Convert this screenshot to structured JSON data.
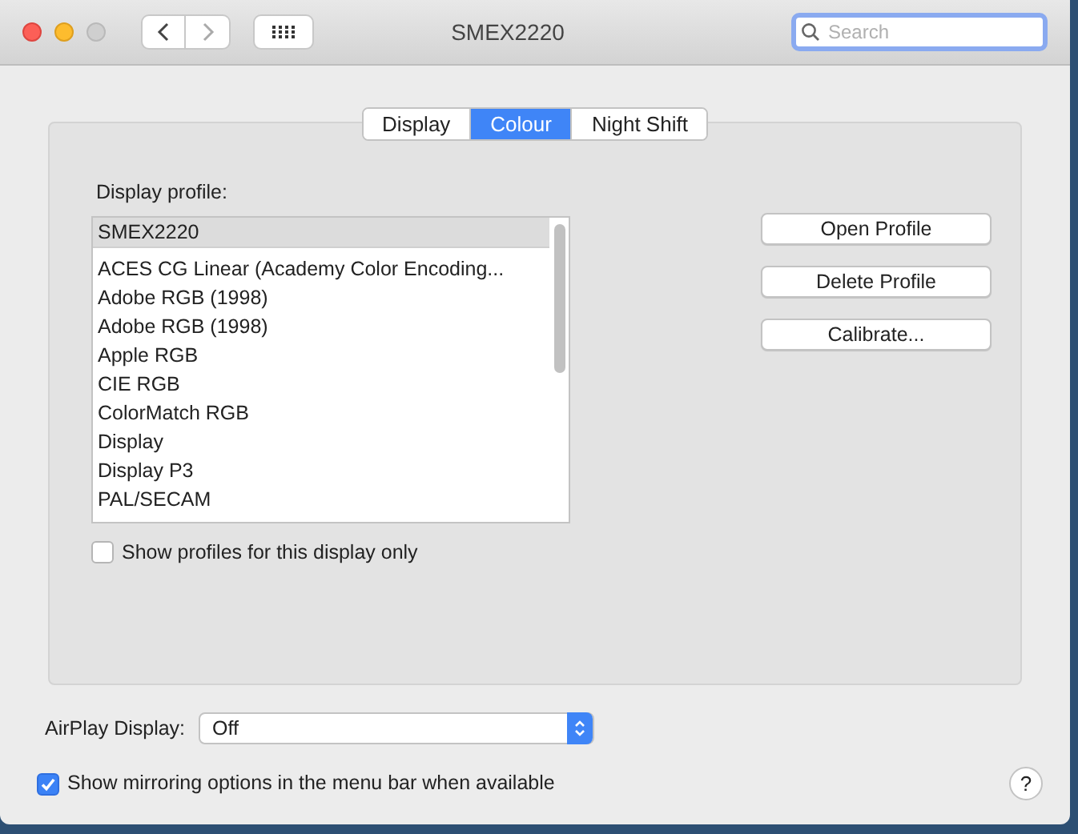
{
  "window": {
    "title": "SMEX2220",
    "search": {
      "placeholder": "Search"
    }
  },
  "tabs": [
    {
      "label": "Display",
      "selected": false
    },
    {
      "label": "Colour",
      "selected": true
    },
    {
      "label": "Night Shift",
      "selected": false
    }
  ],
  "profile_label": "Display profile:",
  "profiles": [
    {
      "label": "SMEX2220",
      "selected": true
    },
    {
      "label": "ACES CG Linear (Academy Color Encoding...",
      "selected": false
    },
    {
      "label": "Adobe RGB (1998)",
      "selected": false
    },
    {
      "label": "Adobe RGB (1998)",
      "selected": false
    },
    {
      "label": "Apple RGB",
      "selected": false
    },
    {
      "label": "CIE RGB",
      "selected": false
    },
    {
      "label": "ColorMatch RGB",
      "selected": false
    },
    {
      "label": "Display",
      "selected": false
    },
    {
      "label": "Display P3",
      "selected": false
    },
    {
      "label": "PAL/SECAM",
      "selected": false
    }
  ],
  "buttons": [
    "Open Profile",
    "Delete Profile",
    "Calibrate..."
  ],
  "show_profiles_checkbox": {
    "label": "Show profiles for this display only",
    "checked": false
  },
  "airplay": {
    "label": "AirPlay Display:",
    "value": "Off"
  },
  "mirroring_checkbox": {
    "label": "Show mirroring options in the menu bar when available",
    "checked": true
  },
  "help": "?"
}
